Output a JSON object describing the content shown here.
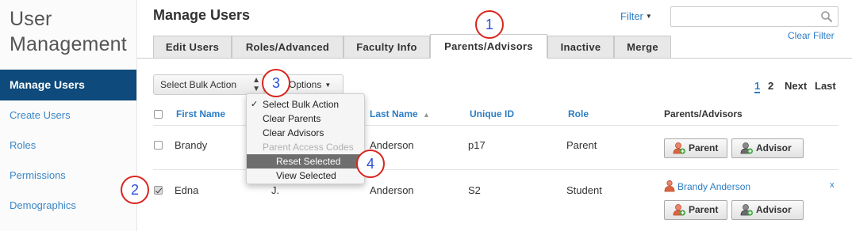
{
  "sidebar": {
    "title_line1": "User",
    "title_line2": "Management",
    "items": [
      {
        "label": "Manage Users"
      },
      {
        "label": "Create Users"
      },
      {
        "label": "Roles"
      },
      {
        "label": "Permissions"
      },
      {
        "label": "Demographics"
      }
    ]
  },
  "header": {
    "title": "Manage Users",
    "filter_label": "Filter",
    "search_placeholder": "",
    "clear_filter_label": "Clear Filter"
  },
  "tabs": [
    {
      "label": "Edit Users"
    },
    {
      "label": "Roles/Advanced"
    },
    {
      "label": "Faculty Info"
    },
    {
      "label": "Parents/Advisors",
      "active": true
    },
    {
      "label": "Inactive"
    },
    {
      "label": "Merge"
    }
  ],
  "toolbar": {
    "bulk_action_value": "Select Bulk Action",
    "options_label": "Options",
    "pagination": {
      "pages": [
        "1",
        "2"
      ],
      "current": "1",
      "next": "Next",
      "last": "Last"
    }
  },
  "bulk_dropdown": {
    "items": [
      {
        "label": "Select Bulk Action",
        "checked": true
      },
      {
        "label": "Clear Parents"
      },
      {
        "label": "Clear Advisors"
      },
      {
        "label": "Parent Access Codes",
        "disabled": true
      },
      {
        "label": "Reset Selected",
        "highlighted": true
      },
      {
        "label": "View Selected"
      }
    ],
    "check_glyph": "✓"
  },
  "table": {
    "headers": {
      "first_name": "First Name",
      "last_name": "Last Name",
      "unique_id": "Unique ID",
      "role": "Role",
      "parents_advisors": "Parents/Advisors"
    },
    "rows": [
      {
        "first_name": "Brandy",
        "middle": "",
        "last_name": "Anderson",
        "unique_id": "p17",
        "role": "Parent",
        "checked": false,
        "linked": ""
      },
      {
        "first_name": "Edna",
        "middle": "J.",
        "last_name": "Anderson",
        "unique_id": "S2",
        "role": "Student",
        "checked": true,
        "linked": "Brandy Anderson",
        "remove": "x"
      }
    ],
    "parent_button_label": "Parent",
    "advisor_button_label": "Advisor"
  },
  "callouts": [
    "1",
    "2",
    "3",
    "4"
  ],
  "colors": {
    "sidebar_active": "#0e4a7b",
    "link": "#2c7dc5",
    "callout_ring": "#d9251d",
    "callout_text": "#2a4fd6"
  },
  "icons": {
    "search": "magnifier-icon",
    "person_add": "person-add-icon",
    "person": "person-icon"
  }
}
